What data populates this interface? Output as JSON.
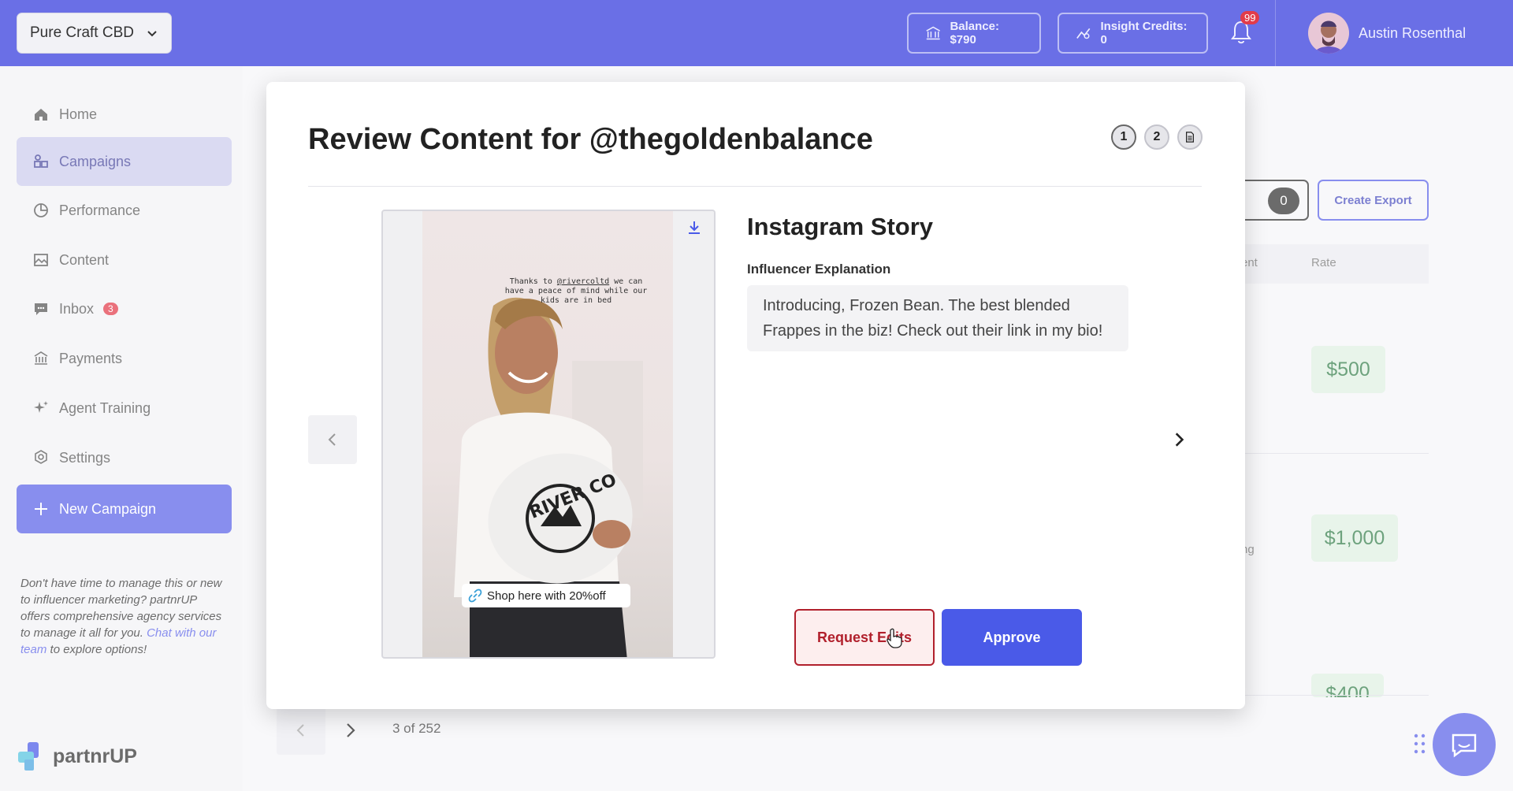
{
  "header": {
    "brand_select": "Pure Craft CBD",
    "balance": "Balance: $790",
    "insight_credits": "Insight Credits: 0",
    "notification_count": "99",
    "user_name": "Austin Rosenthal"
  },
  "sidebar": {
    "items": [
      {
        "label": "Home",
        "icon": "home-icon"
      },
      {
        "label": "Campaigns",
        "icon": "campaigns-icon",
        "active": true
      },
      {
        "label": "Performance",
        "icon": "performance-icon"
      },
      {
        "label": "Content",
        "icon": "content-icon"
      },
      {
        "label": "Inbox",
        "icon": "inbox-icon",
        "badge": "3"
      },
      {
        "label": "Payments",
        "icon": "payments-icon"
      },
      {
        "label": "Agent Training",
        "icon": "sparkle-icon"
      },
      {
        "label": "Settings",
        "icon": "settings-icon"
      }
    ],
    "new_campaign": "New Campaign",
    "promo_text_1": "Don't have time to manage this or new to influencer marketing? partnrUP offers comprehensive agency services to manage it all for you.",
    "promo_link": "Chat with our team",
    "promo_text_2": "to explore options!",
    "logo_text": "partnrUP"
  },
  "background": {
    "filter_count": "0",
    "create_export": "Create Export",
    "col_partial": "ent",
    "col_rate": "Rate",
    "row_partial": "ng",
    "rates": [
      "$500",
      "$1,000",
      "$400"
    ],
    "pagination": "3 of 252"
  },
  "modal": {
    "title": "Review Content for @thegoldenbalance",
    "steps": [
      "1",
      "2"
    ],
    "content_type": "Instagram Story",
    "explanation_label": "Influencer Explanation",
    "explanation_text": "Introducing, Frozen Bean. The best blended Frappes in the biz! Check out their link in my bio!",
    "story_caption_pre": "Thanks to ",
    "story_caption_handle": "@rivercoltd",
    "story_caption_post": " we can have a peace of mind while our kids are in bed",
    "pillow_text": "RIVER CO",
    "shop_chip": "Shop here with 20%off",
    "request_edits": "Request Edits",
    "approve": "Approve"
  },
  "colors": {
    "header": "#6a6fe6",
    "primary": "#4a5ae8",
    "active_nav": "#ccccee",
    "danger": "#b1202c",
    "rate_green": "#357e4b"
  }
}
